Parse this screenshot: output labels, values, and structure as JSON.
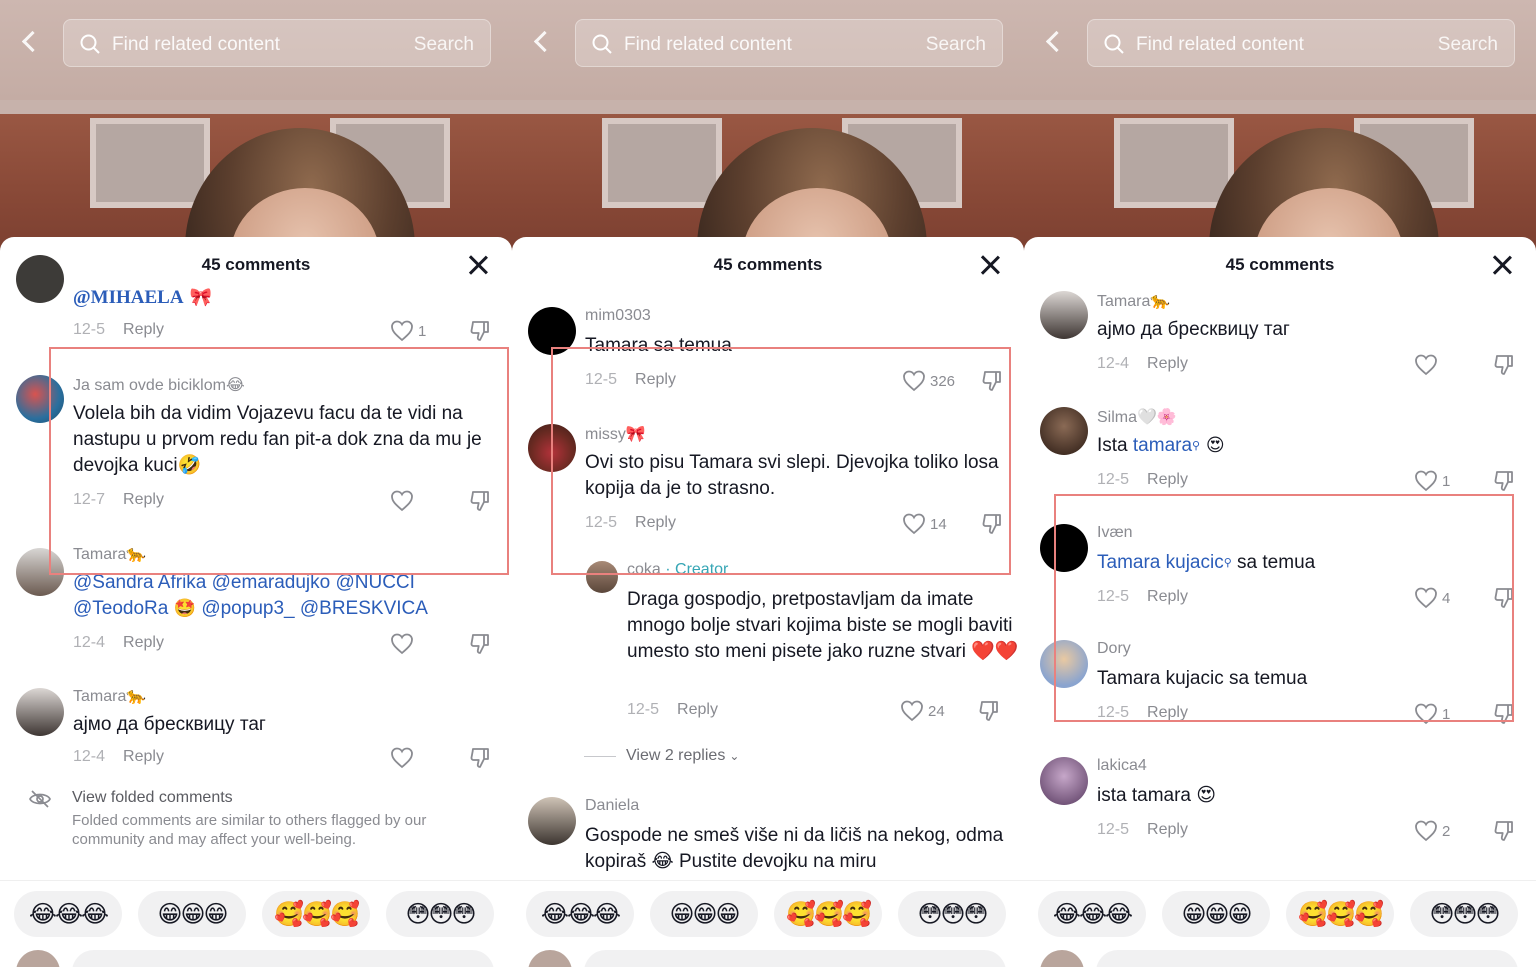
{
  "common": {
    "search_placeholder": "Find related content",
    "search_button": "Search",
    "comments_title": "45 comments",
    "reply_label": "Reply"
  },
  "emoji_chips": [
    "😂😂😂",
    "😁😁😁",
    "🥰🥰🥰",
    "😳😳😳"
  ],
  "panel1": {
    "comments": [
      {
        "user": "",
        "text_parts": [
          {
            "mention": "@MIHAELA"
          },
          {
            "plain": " 🎀"
          }
        ],
        "date": "12-5",
        "likes": "1"
      },
      {
        "user": "Ja sam ovde biciklom😂",
        "text": "Volela bih da vidim Vojazevu facu da te vidi na nastupu u prvom redu fan pit-a dok zna da mu je devojka kuci🤣",
        "date": "12-7",
        "likes": ""
      },
      {
        "user": "Tamara🐆",
        "mentions_line1": "@Sandra Afrika @emaradujko @NUCCI",
        "mentions_line2a": "@TeodoRa",
        "mentions_line2_emoji": "🤩",
        "mentions_line2b": "@popup3_ @BRESKVICA",
        "date": "12-4",
        "likes": ""
      },
      {
        "user": "Tamara🐆",
        "text": "ајмо да бресквицу таг",
        "date": "12-4",
        "likes": ""
      }
    ],
    "folded_title": "View folded comments",
    "folded_desc": "Folded comments are similar to others flagged by our community and may affect your well-being."
  },
  "panel2": {
    "comments": [
      {
        "user": "mim0303",
        "text": "Tamara sa temua",
        "date": "12-5",
        "likes": "326"
      },
      {
        "user": "missy🎀",
        "text": "Ovi sto pisu Tamara svi slepi. Djevojka toliko losa kopija da je to strasno.",
        "date": "12-5",
        "likes": "14"
      },
      {
        "user": "coka",
        "creator": " · Creator",
        "text": "Draga gospodjo, pretpostavljam da imate mnogo bolje stvari kojima biste se mogli baviti umesto sto meni pisete jako ruzne stvari ❤️❤️",
        "date": "12-5",
        "likes": "24"
      },
      {
        "user": "Daniela",
        "text": "Gospode ne smeš više ni da ličiš na nekog, odma kopiraš 😂 Pustite devojku na miru",
        "date": "",
        "likes": ""
      }
    ],
    "view_replies": "View 2 replies"
  },
  "panel3": {
    "comments": [
      {
        "user": "Tamara🐆",
        "text": "ајмо да бресквицу таг",
        "date": "12-4",
        "likes": ""
      },
      {
        "user": "Silma🤍🌸",
        "text_prefix": "Ista ",
        "mention": "tamara",
        "text_suffix": " 😍",
        "date": "12-5",
        "likes": "1"
      },
      {
        "user": "Ivæn",
        "mention": "Tamara kujacic",
        "text_suffix": " sa temua",
        "date": "12-5",
        "likes": "4"
      },
      {
        "user": "Dory",
        "text": "Tamara kujacic sa temua",
        "date": "12-5",
        "likes": "1"
      },
      {
        "user": "lakica4",
        "text": "ista tamara 😍",
        "date": "12-5",
        "likes": "2"
      }
    ]
  },
  "colors": {
    "highlight": "#e9817e",
    "mention": "#2b5db9",
    "creator": "#37a6b5"
  }
}
